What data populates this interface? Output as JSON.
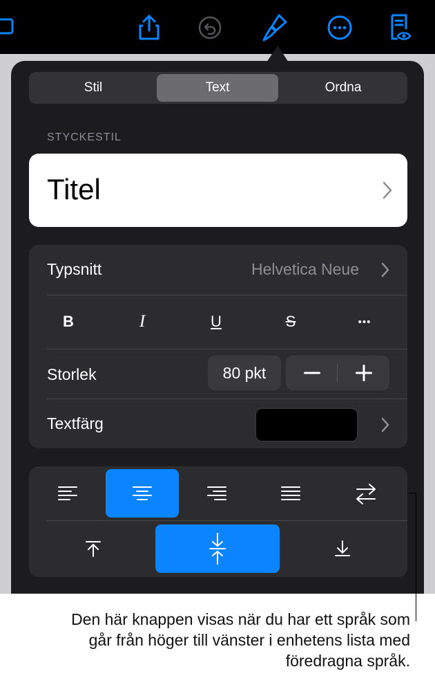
{
  "popover": {
    "tabs": [
      {
        "label": "Stil",
        "active": false
      },
      {
        "label": "Text",
        "active": true
      },
      {
        "label": "Ordna",
        "active": false
      }
    ],
    "section_label": "STYCKESTIL",
    "paragraph_style": "Titel",
    "font": {
      "label": "Typsnitt",
      "value": "Helvetica Neue"
    },
    "format_buttons": {
      "bold": "B",
      "italic": "I",
      "underline": "U",
      "strike": "S",
      "more": "•••"
    },
    "size": {
      "label": "Storlek",
      "value": "80 pkt",
      "minus": "−",
      "plus": "+"
    },
    "text_color": {
      "label": "Textfärg",
      "value": "#000000"
    },
    "horizontal_alignment_selected": "center",
    "vertical_alignment_selected": "middle"
  },
  "callout": {
    "text": "Den här knappen visas när du har ett språk som går från höger till vänster i enhetens lista med föredragna språk."
  },
  "colors": {
    "accent": "#0a84ff",
    "toolbar_icon": "#0a84ff",
    "panel": "#1c1c1e",
    "card": "#2c2c2e"
  }
}
